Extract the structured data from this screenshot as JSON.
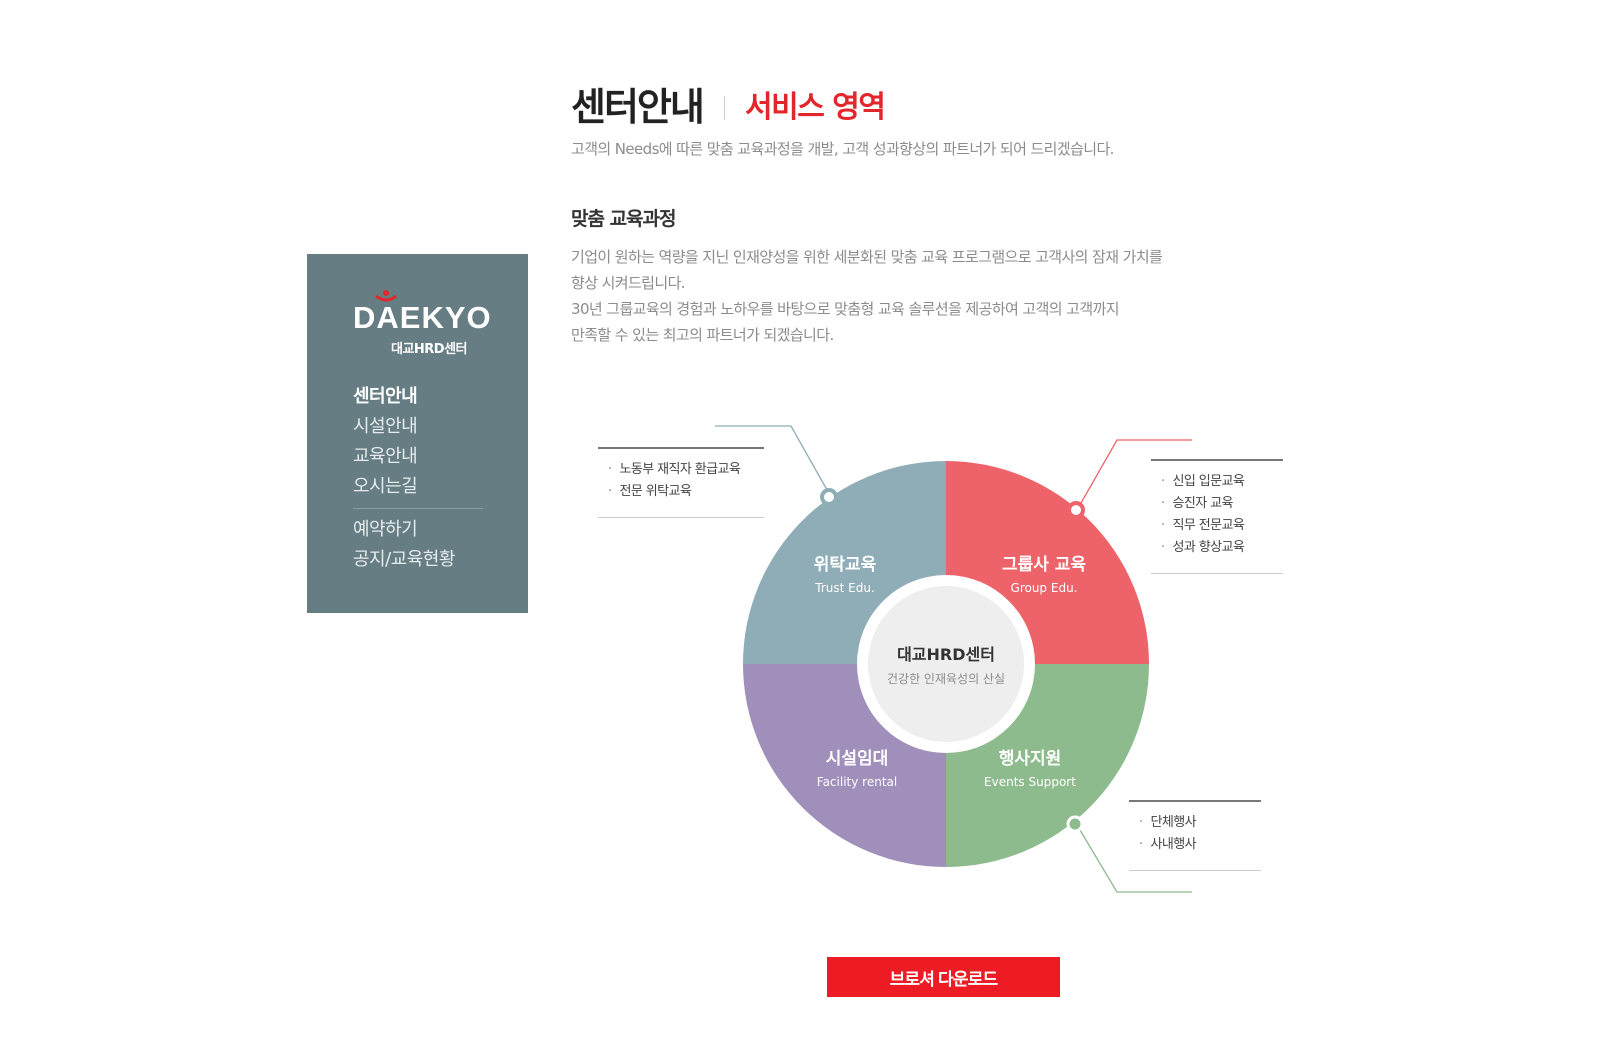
{
  "sidebar": {
    "logo_text": "DAEKYO",
    "logo_sub": "대교HRD센터",
    "menu": [
      {
        "label": "센터안내",
        "active": true
      },
      {
        "label": "시설안내",
        "active": false
      },
      {
        "label": "교육안내",
        "active": false
      },
      {
        "label": "오시는길",
        "active": false
      }
    ],
    "menu_secondary": [
      {
        "label": "예약하기"
      },
      {
        "label": "공지/교육현황"
      }
    ]
  },
  "header": {
    "title": "센터안내",
    "subtitle": "서비스 영역",
    "description": "고객의 Needs에 따른 맞춤 교육과정을 개발, 고객 성과향상의 파트너가 되어 드리겠습니다."
  },
  "section": {
    "title": "맞춤 교육과정",
    "lines": [
      "기업이 원하는 역량을 지닌 인재양성을 위한 세분화된 맞춤 교육 프로그램으로 고객사의 잠재 가치를",
      "향상 시켜드립니다.",
      "30년 그룹교육의 경험과 노하우를 바탕으로 맞춤형 교육 솔루션을 제공하여 고객의 고객까지",
      "만족할 수 있는 최고의 파트너가 되겠습니다."
    ]
  },
  "diagram": {
    "center_title": "대교HRD센터",
    "center_sub": "건강한 인재육성의 산실",
    "quadrants": {
      "trust": {
        "title": "위탁교육",
        "sub": "Trust Edu.",
        "color": "#8eadb7"
      },
      "group": {
        "title": "그룹사 교육",
        "sub": "Group Edu.",
        "color": "#ee6369"
      },
      "facility": {
        "title": "시설임대",
        "sub": "Facility rental",
        "color": "#a08ebb"
      },
      "events": {
        "title": "행사지원",
        "sub": "Events Support",
        "color": "#8dbb8d"
      }
    },
    "notes": {
      "trust": [
        "노동부 재직자 환급교육",
        "전문 위탁교육"
      ],
      "group": [
        "신입 입문교육",
        "승진자 교육",
        "직무 전문교육",
        "성과 향상교육"
      ],
      "events": [
        "단체행사",
        "사내행사"
      ]
    }
  },
  "download_label": "브로셔 다운로드",
  "colors": {
    "accent_red": "#e3262b",
    "button_red": "#ed1c24",
    "sidebar_bg": "#667d84"
  }
}
